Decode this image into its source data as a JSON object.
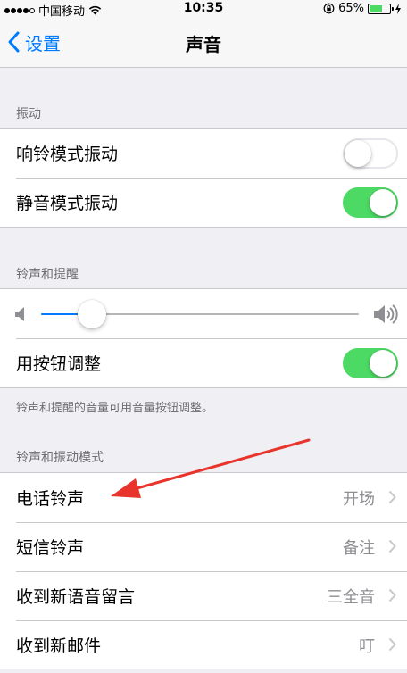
{
  "status_bar": {
    "carrier": "中国移动",
    "time": "10:35",
    "battery": "65%",
    "battery_level": 0.65
  },
  "nav": {
    "back_label": "设置",
    "title": "声音"
  },
  "vibrate": {
    "header": "振动",
    "items": [
      {
        "label": "响铃模式振动",
        "on": false
      },
      {
        "label": "静音模式振动",
        "on": true
      }
    ]
  },
  "ringer": {
    "header": "铃声和提醒",
    "volume_level": 0.16,
    "change_with_buttons": {
      "label": "用按钮调整",
      "on": true
    },
    "footer": "铃声和提醒的音量可用音量按钮调整。"
  },
  "sounds": {
    "header": "铃声和振动模式",
    "items": [
      {
        "label": "电话铃声",
        "value": "开场"
      },
      {
        "label": "短信铃声",
        "value": "备注"
      },
      {
        "label": "收到新语音留言",
        "value": "三全音"
      },
      {
        "label": "收到新邮件",
        "value": "叮"
      }
    ]
  },
  "colors": {
    "accent": "#007aff",
    "toggle_on": "#4cd964",
    "annotation": "#e8342c"
  }
}
